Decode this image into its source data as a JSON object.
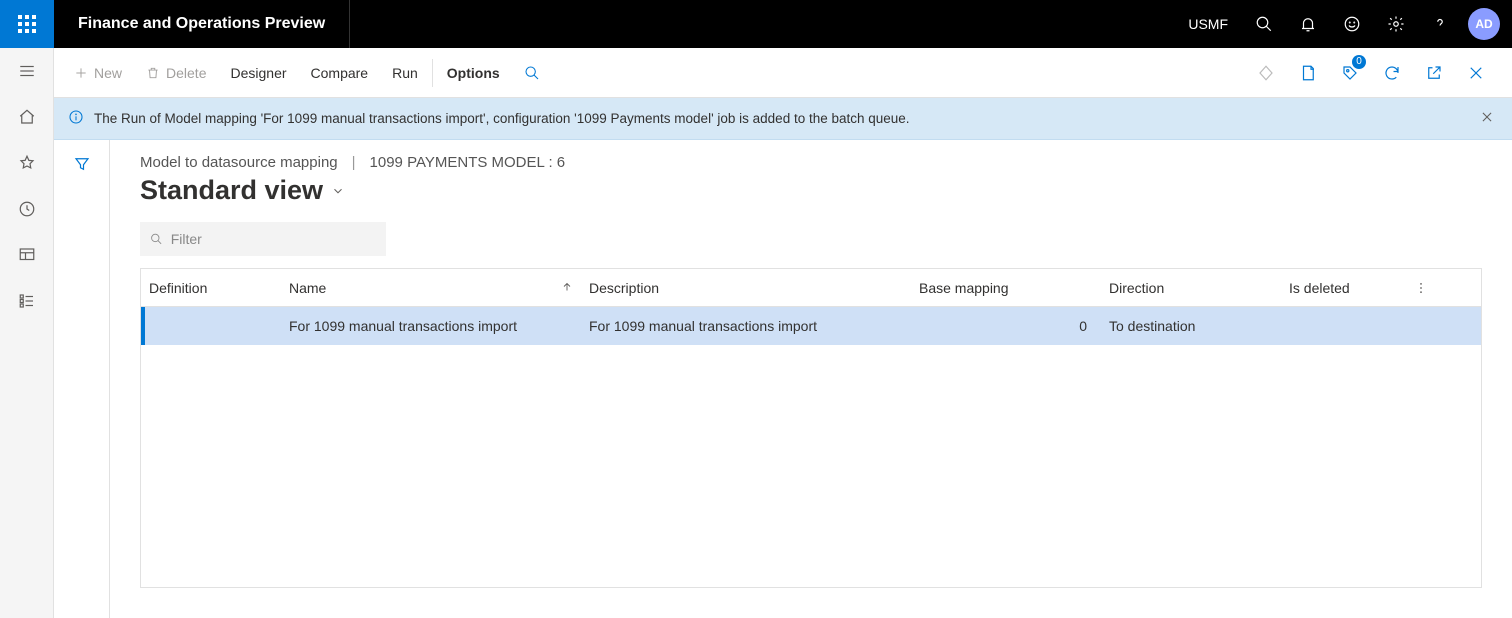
{
  "header": {
    "app_title": "Finance and Operations Preview",
    "company": "USMF",
    "avatar": "AD"
  },
  "action_bar": {
    "new_label": "New",
    "delete_label": "Delete",
    "designer_label": "Designer",
    "compare_label": "Compare",
    "run_label": "Run",
    "options_label": "Options",
    "badge_count": "0"
  },
  "notification": {
    "text": "The Run of Model mapping 'For 1099 manual transactions import', configuration '1099 Payments model' job is added to the batch queue."
  },
  "breadcrumb": {
    "part1": "Model to datasource mapping",
    "part2": "1099 PAYMENTS MODEL : 6"
  },
  "page": {
    "title": "Standard view",
    "filter_placeholder": "Filter"
  },
  "grid": {
    "columns": {
      "definition": "Definition",
      "name": "Name",
      "description": "Description",
      "base_mapping": "Base mapping",
      "direction": "Direction",
      "is_deleted": "Is deleted"
    },
    "rows": [
      {
        "definition": "",
        "name": "For 1099 manual transactions import",
        "description": "For 1099 manual transactions import",
        "base_mapping": "0",
        "direction": "To destination",
        "is_deleted": ""
      }
    ]
  }
}
